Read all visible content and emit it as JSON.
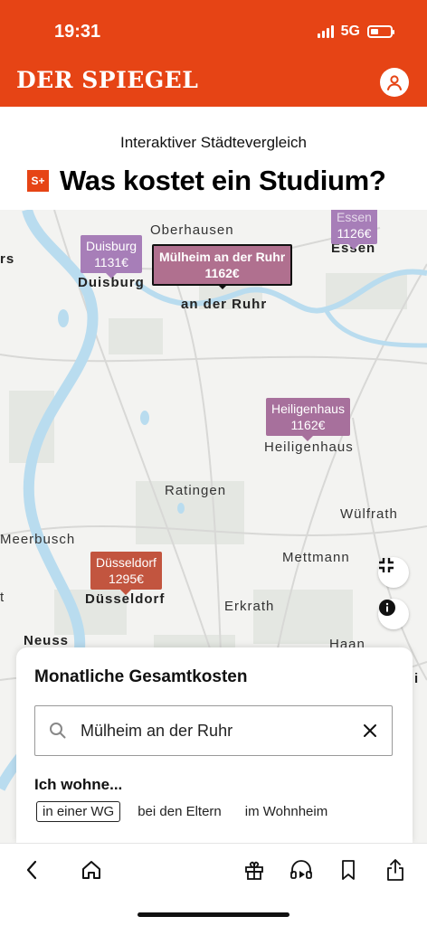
{
  "status": {
    "time": "19:31",
    "network": "5G"
  },
  "header": {
    "brand": "DER SPIEGEL",
    "user_icon": "user-icon"
  },
  "article": {
    "kicker": "Interaktiver Städtevergleich",
    "badge": "S+",
    "title": "Was kostet ein Studium?"
  },
  "map": {
    "cities": {
      "oberhausen": "Oberhausen",
      "essen": "Essen",
      "duisburg": "Duisburg",
      "muelheim_line1": "Mülheim",
      "muelheim_line2": "an der Ruhr",
      "heiligenhaus": "Heiligenhaus",
      "ratingen": "Ratingen",
      "wuelfrath": "Wülfrath",
      "meerbusch": "Meerbusch",
      "mettmann": "Mettmann",
      "duesseldorf": "Düsseldorf",
      "erkrath": "Erkrath",
      "neuss": "Neuss",
      "haan": "Haan",
      "rs_fragment": "rs",
      "t_fragment": "t",
      "i_fragment": "i"
    },
    "markers": {
      "essen": {
        "name": "Essen",
        "price": "1126€",
        "color": "#a77eb8"
      },
      "duisburg": {
        "name": "Duisburg",
        "price": "1131€",
        "color": "#a77eb8"
      },
      "muelheim": {
        "name": "Mülheim an der Ruhr",
        "price": "1162€",
        "color": "#b0708f"
      },
      "heiligenhaus": {
        "name": "Heiligenhaus",
        "price": "1162€",
        "color": "#a7709c"
      },
      "duesseldorf": {
        "name": "Düsseldorf",
        "price": "1295€",
        "color": "#c2553f"
      }
    },
    "controls": {
      "fullscreen_icon": "collapse-icon",
      "info_icon": "info-icon"
    }
  },
  "panel": {
    "title": "Monatliche Gesamtkosten",
    "search_value": "Mülheim an der Ruhr",
    "wohne_label": "Ich wohne...",
    "options": [
      "in einer WG",
      "bei den Eltern",
      "im Wohnheim"
    ],
    "active_option": "in einer WG"
  },
  "bottom_nav": [
    "back-icon",
    "home-icon",
    "gift-icon",
    "audio-icon",
    "bookmark-icon",
    "share-icon"
  ]
}
